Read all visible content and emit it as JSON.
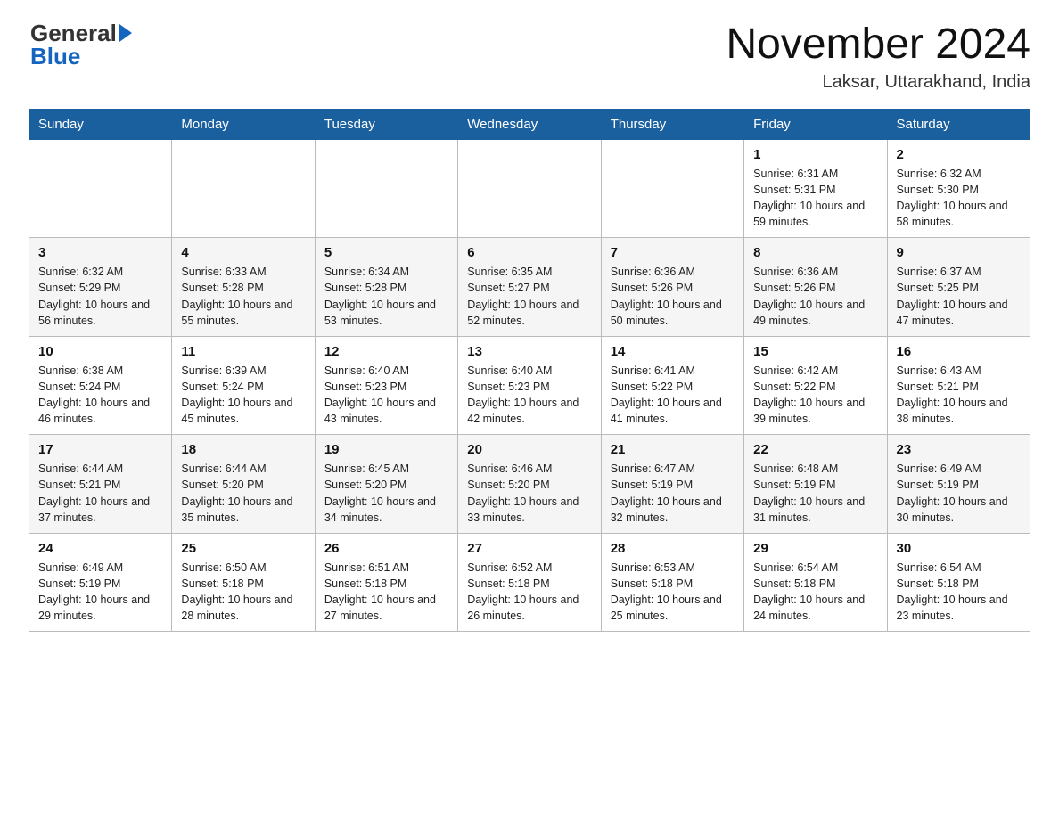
{
  "header": {
    "logo_general": "General",
    "logo_blue": "Blue",
    "month_year": "November 2024",
    "location": "Laksar, Uttarakhand, India"
  },
  "weekdays": [
    "Sunday",
    "Monday",
    "Tuesday",
    "Wednesday",
    "Thursday",
    "Friday",
    "Saturday"
  ],
  "weeks": [
    [
      {
        "day": "",
        "info": ""
      },
      {
        "day": "",
        "info": ""
      },
      {
        "day": "",
        "info": ""
      },
      {
        "day": "",
        "info": ""
      },
      {
        "day": "",
        "info": ""
      },
      {
        "day": "1",
        "info": "Sunrise: 6:31 AM\nSunset: 5:31 PM\nDaylight: 10 hours and 59 minutes."
      },
      {
        "day": "2",
        "info": "Sunrise: 6:32 AM\nSunset: 5:30 PM\nDaylight: 10 hours and 58 minutes."
      }
    ],
    [
      {
        "day": "3",
        "info": "Sunrise: 6:32 AM\nSunset: 5:29 PM\nDaylight: 10 hours and 56 minutes."
      },
      {
        "day": "4",
        "info": "Sunrise: 6:33 AM\nSunset: 5:28 PM\nDaylight: 10 hours and 55 minutes."
      },
      {
        "day": "5",
        "info": "Sunrise: 6:34 AM\nSunset: 5:28 PM\nDaylight: 10 hours and 53 minutes."
      },
      {
        "day": "6",
        "info": "Sunrise: 6:35 AM\nSunset: 5:27 PM\nDaylight: 10 hours and 52 minutes."
      },
      {
        "day": "7",
        "info": "Sunrise: 6:36 AM\nSunset: 5:26 PM\nDaylight: 10 hours and 50 minutes."
      },
      {
        "day": "8",
        "info": "Sunrise: 6:36 AM\nSunset: 5:26 PM\nDaylight: 10 hours and 49 minutes."
      },
      {
        "day": "9",
        "info": "Sunrise: 6:37 AM\nSunset: 5:25 PM\nDaylight: 10 hours and 47 minutes."
      }
    ],
    [
      {
        "day": "10",
        "info": "Sunrise: 6:38 AM\nSunset: 5:24 PM\nDaylight: 10 hours and 46 minutes."
      },
      {
        "day": "11",
        "info": "Sunrise: 6:39 AM\nSunset: 5:24 PM\nDaylight: 10 hours and 45 minutes."
      },
      {
        "day": "12",
        "info": "Sunrise: 6:40 AM\nSunset: 5:23 PM\nDaylight: 10 hours and 43 minutes."
      },
      {
        "day": "13",
        "info": "Sunrise: 6:40 AM\nSunset: 5:23 PM\nDaylight: 10 hours and 42 minutes."
      },
      {
        "day": "14",
        "info": "Sunrise: 6:41 AM\nSunset: 5:22 PM\nDaylight: 10 hours and 41 minutes."
      },
      {
        "day": "15",
        "info": "Sunrise: 6:42 AM\nSunset: 5:22 PM\nDaylight: 10 hours and 39 minutes."
      },
      {
        "day": "16",
        "info": "Sunrise: 6:43 AM\nSunset: 5:21 PM\nDaylight: 10 hours and 38 minutes."
      }
    ],
    [
      {
        "day": "17",
        "info": "Sunrise: 6:44 AM\nSunset: 5:21 PM\nDaylight: 10 hours and 37 minutes."
      },
      {
        "day": "18",
        "info": "Sunrise: 6:44 AM\nSunset: 5:20 PM\nDaylight: 10 hours and 35 minutes."
      },
      {
        "day": "19",
        "info": "Sunrise: 6:45 AM\nSunset: 5:20 PM\nDaylight: 10 hours and 34 minutes."
      },
      {
        "day": "20",
        "info": "Sunrise: 6:46 AM\nSunset: 5:20 PM\nDaylight: 10 hours and 33 minutes."
      },
      {
        "day": "21",
        "info": "Sunrise: 6:47 AM\nSunset: 5:19 PM\nDaylight: 10 hours and 32 minutes."
      },
      {
        "day": "22",
        "info": "Sunrise: 6:48 AM\nSunset: 5:19 PM\nDaylight: 10 hours and 31 minutes."
      },
      {
        "day": "23",
        "info": "Sunrise: 6:49 AM\nSunset: 5:19 PM\nDaylight: 10 hours and 30 minutes."
      }
    ],
    [
      {
        "day": "24",
        "info": "Sunrise: 6:49 AM\nSunset: 5:19 PM\nDaylight: 10 hours and 29 minutes."
      },
      {
        "day": "25",
        "info": "Sunrise: 6:50 AM\nSunset: 5:18 PM\nDaylight: 10 hours and 28 minutes."
      },
      {
        "day": "26",
        "info": "Sunrise: 6:51 AM\nSunset: 5:18 PM\nDaylight: 10 hours and 27 minutes."
      },
      {
        "day": "27",
        "info": "Sunrise: 6:52 AM\nSunset: 5:18 PM\nDaylight: 10 hours and 26 minutes."
      },
      {
        "day": "28",
        "info": "Sunrise: 6:53 AM\nSunset: 5:18 PM\nDaylight: 10 hours and 25 minutes."
      },
      {
        "day": "29",
        "info": "Sunrise: 6:54 AM\nSunset: 5:18 PM\nDaylight: 10 hours and 24 minutes."
      },
      {
        "day": "30",
        "info": "Sunrise: 6:54 AM\nSunset: 5:18 PM\nDaylight: 10 hours and 23 minutes."
      }
    ]
  ]
}
